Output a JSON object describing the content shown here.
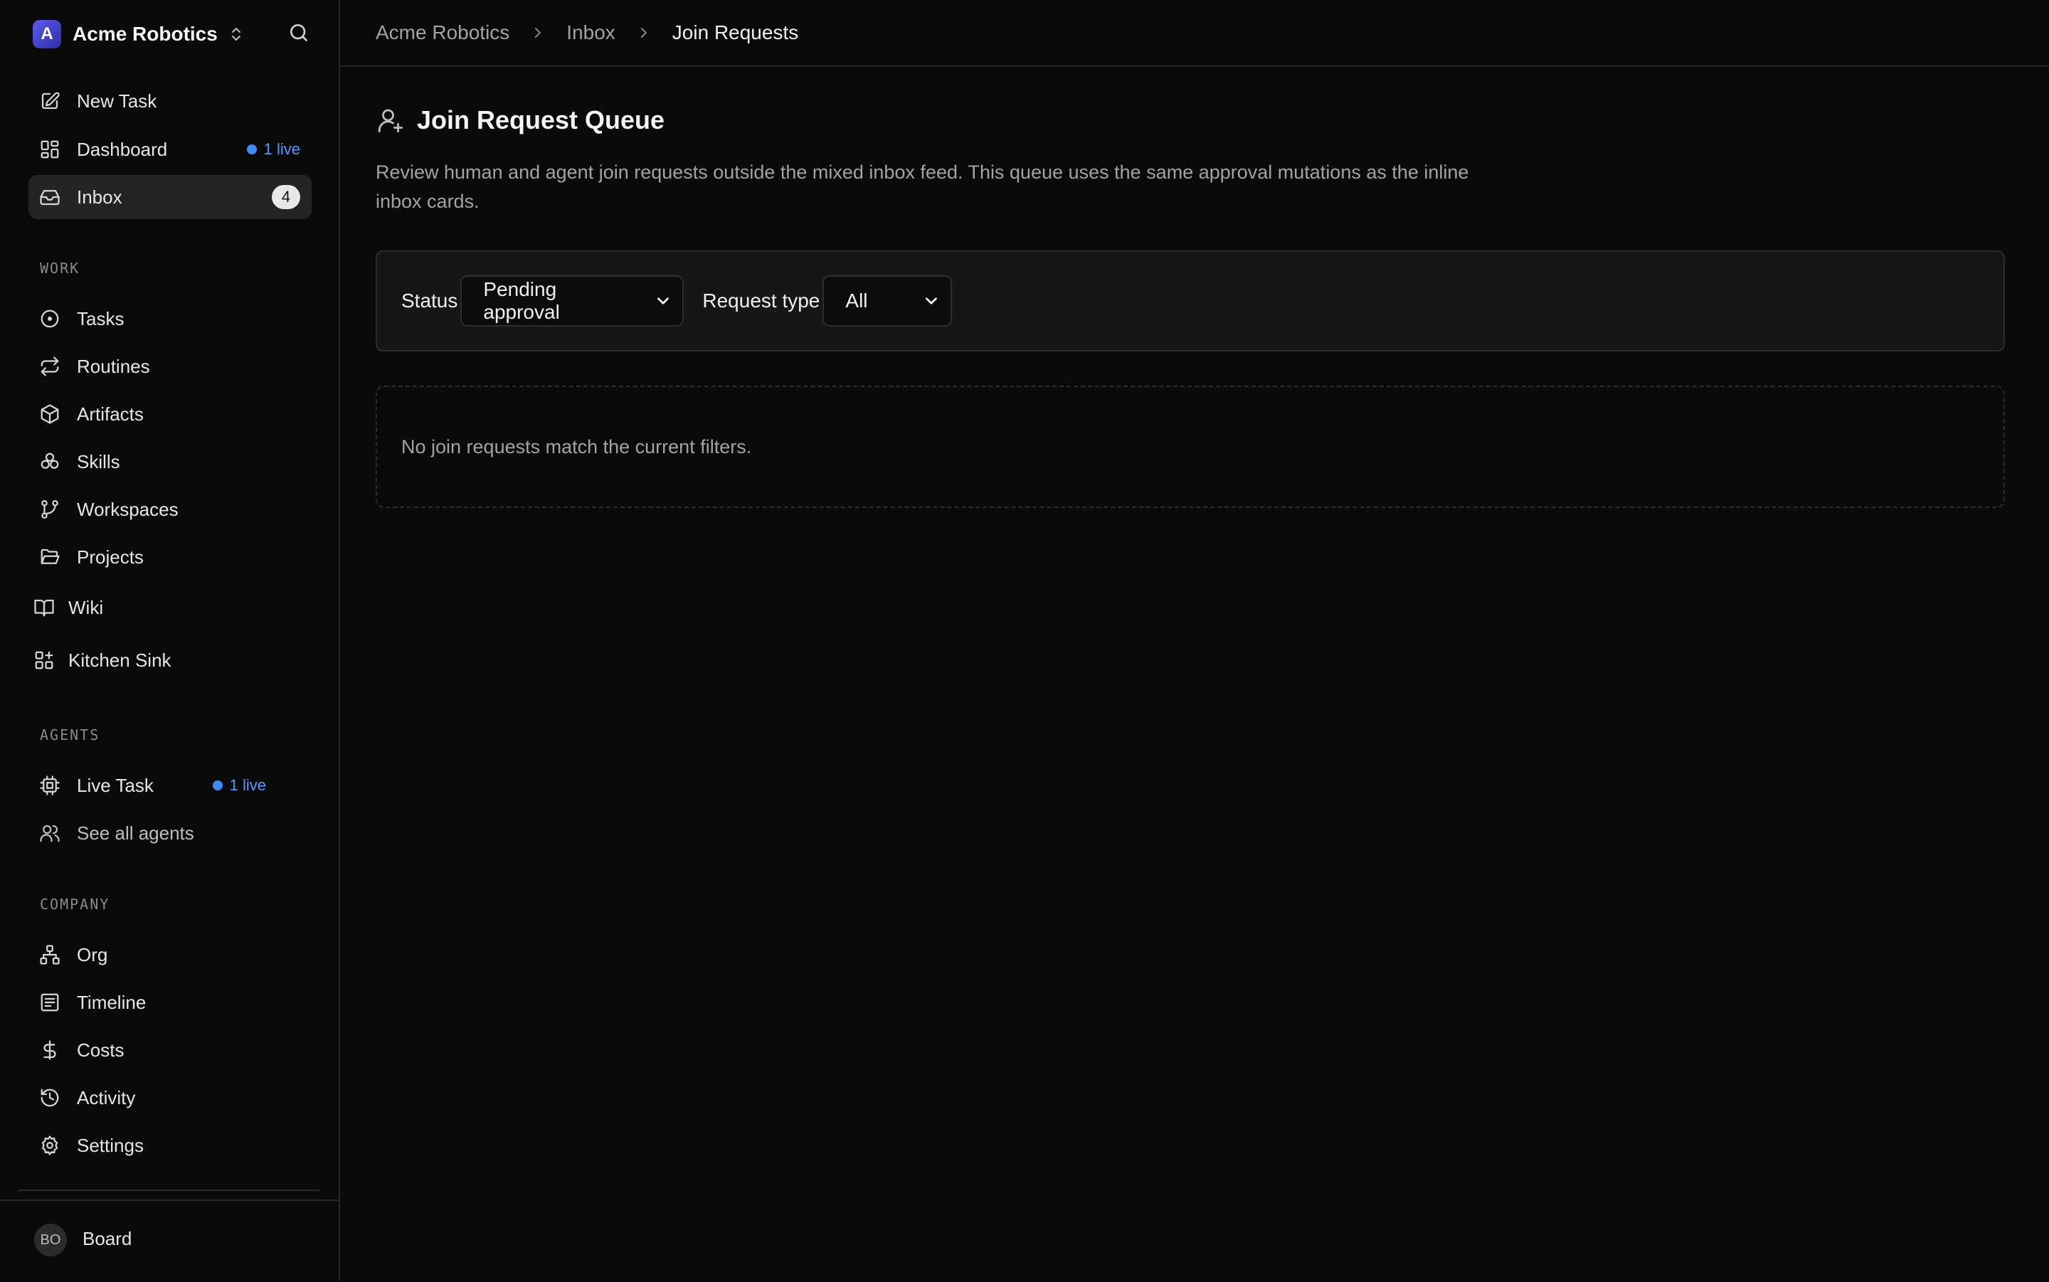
{
  "workspace": {
    "name": "Acme Robotics",
    "logo_letter": "A"
  },
  "sidebar": {
    "top_items": [
      {
        "label": "New Task",
        "icon": "edit-icon"
      },
      {
        "label": "Dashboard",
        "icon": "dashboard-icon",
        "live": "1 live"
      },
      {
        "label": "Inbox",
        "icon": "inbox-icon",
        "count": "4"
      }
    ],
    "work_label": "WORK",
    "work_items": [
      {
        "label": "Tasks",
        "icon": "circle-dot-icon"
      },
      {
        "label": "Routines",
        "icon": "repeat-icon"
      },
      {
        "label": "Artifacts",
        "icon": "box-icon"
      },
      {
        "label": "Skills",
        "icon": "boxes-icon"
      },
      {
        "label": "Workspaces",
        "icon": "git-branch-icon"
      },
      {
        "label": "Projects",
        "icon": "folder-open-icon"
      },
      {
        "label": "Wiki",
        "icon": "book-open-icon"
      },
      {
        "label": "Kitchen Sink",
        "icon": "grid-plus-icon"
      }
    ],
    "agents_label": "AGENTS",
    "agent_items": [
      {
        "label": "Live Task",
        "icon": "cpu-icon",
        "live": "1 live"
      },
      {
        "label": "See all agents",
        "icon": "users-icon"
      }
    ],
    "company_label": "COMPANY",
    "company_items": [
      {
        "label": "Org",
        "icon": "network-icon"
      },
      {
        "label": "Timeline",
        "icon": "list-icon"
      },
      {
        "label": "Costs",
        "icon": "dollar-icon"
      },
      {
        "label": "Activity",
        "icon": "history-icon"
      },
      {
        "label": "Settings",
        "icon": "gear-icon"
      }
    ],
    "footer": {
      "avatar_initials": "BO",
      "name": "Board"
    }
  },
  "breadcrumb": [
    "Acme Robotics",
    "Inbox",
    "Join Requests"
  ],
  "page": {
    "title": "Join Request Queue",
    "description": "Review human and agent join requests outside the mixed inbox feed. This queue uses the same approval mutations as the inline inbox cards."
  },
  "filters": {
    "status_label": "Status",
    "status_value": "Pending approval",
    "type_label": "Request type",
    "type_value": "All"
  },
  "empty_message": "No join requests match the current filters.",
  "colors": {
    "accent_live": "#3b8df5",
    "background": "#0a0a0a",
    "active_item": "#242424"
  }
}
